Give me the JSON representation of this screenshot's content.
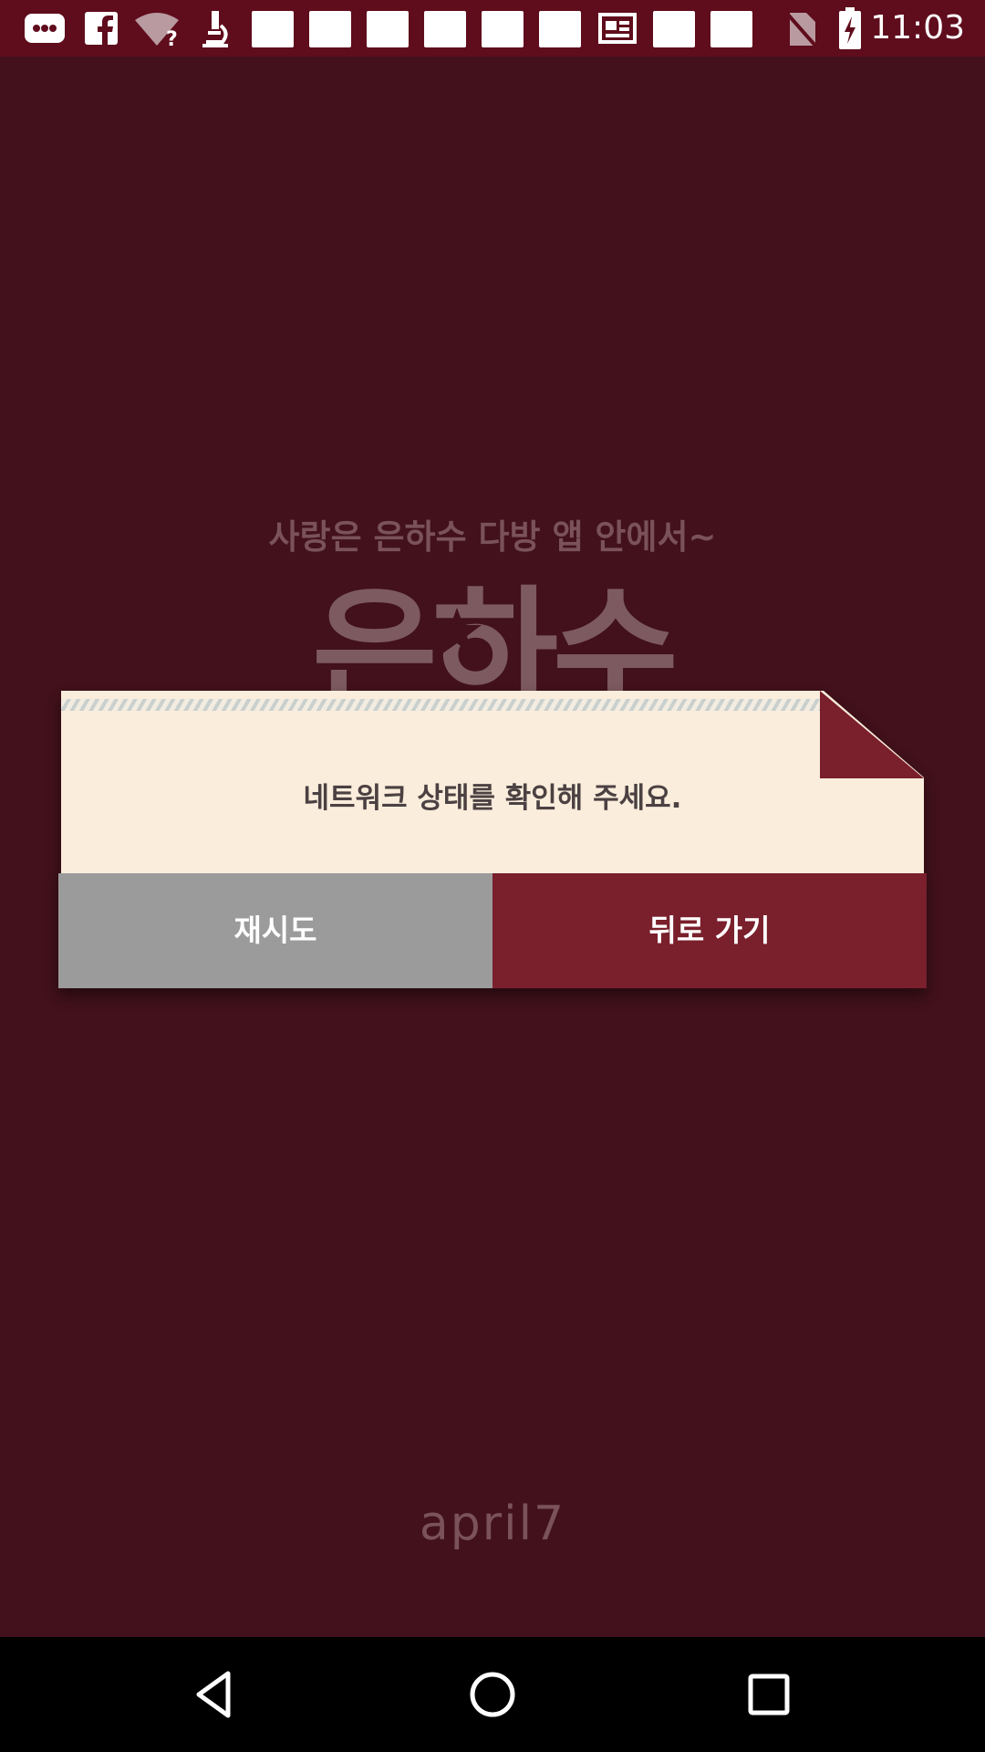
{
  "status_bar": {
    "time": "11:03",
    "icons": [
      "more-icon",
      "facebook-icon",
      "wifi-unknown-icon",
      "microscope-icon",
      "notification-icon",
      "notification-icon",
      "notification-icon",
      "notification-icon",
      "notification-icon",
      "notification-icon",
      "news-icon",
      "notification-icon",
      "notification-icon",
      "no-sim-icon",
      "battery-charging-icon"
    ]
  },
  "splash": {
    "tagline": "사랑은 은하수 다방 앱 안에서~",
    "logo": "은하수",
    "brand": "april7"
  },
  "dialog": {
    "message": "네트워크 상태를 확인해 주세요.",
    "retry_label": "재시도",
    "back_label": "뒤로 가기"
  },
  "nav_bar": {
    "icons": [
      "back-icon",
      "home-icon",
      "recents-icon"
    ]
  },
  "colors": {
    "background": "#42111b",
    "status_bar": "#5f0c1c",
    "accent": "#7a1f2c",
    "paper": "#fbeddc",
    "retry_button": "#9b9b9b"
  }
}
